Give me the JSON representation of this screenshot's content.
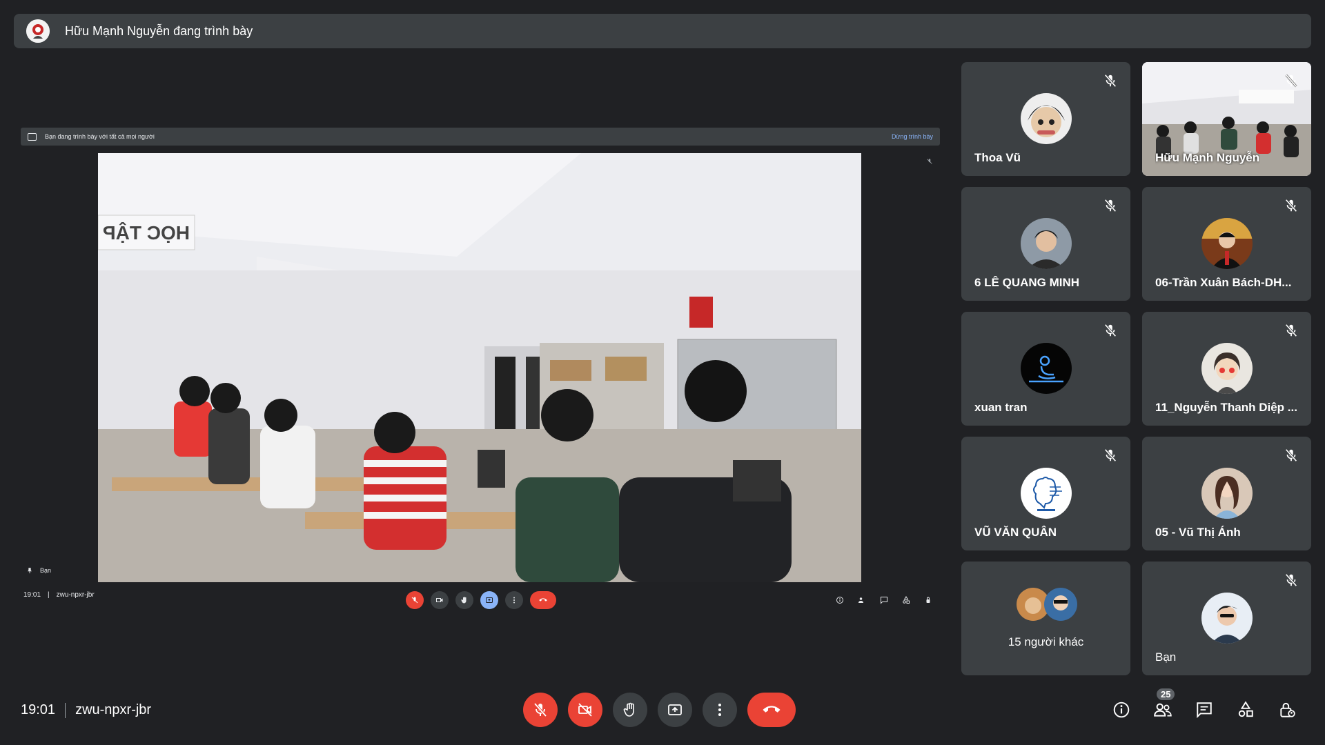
{
  "presenter_bar": {
    "title": "Hữu Mạnh Nguyễn đang trình bày"
  },
  "shared_screen": {
    "notice": "Bạn đang trình bày với tất cả mọi người",
    "stop_label": "Dừng trình bày",
    "self_label": "Bạn",
    "time": "19:01",
    "meeting_code": "zwu-npxr-jbr",
    "people_count": "25"
  },
  "participants": [
    {
      "name": "Thoa Vũ",
      "muted": true,
      "avatar": "cartoon-avatar"
    },
    {
      "name": "Hữu Mạnh Nguyễn",
      "muted": true,
      "avatar": "video-feed"
    },
    {
      "name": "6 LÊ QUANG MINH",
      "muted": true,
      "avatar": "photo-avatar"
    },
    {
      "name": "06-Trần Xuân Bách-DH...",
      "muted": true,
      "avatar": "photo-avatar"
    },
    {
      "name": "xuan tran",
      "muted": true,
      "avatar": "logo-avatar"
    },
    {
      "name": "11_Nguyễn Thanh Diệp ...",
      "muted": true,
      "avatar": "cartoon-avatar"
    },
    {
      "name": "VŨ VĂN QUÂN",
      "muted": true,
      "avatar": "brain-logo-avatar"
    },
    {
      "name": "05 - Vũ Thị Ánh",
      "muted": true,
      "avatar": "photo-avatar"
    },
    {
      "name": "15 người khác",
      "muted": false,
      "avatar": "group-avatars"
    },
    {
      "name": "Bạn",
      "muted": true,
      "avatar": "photo-avatar"
    }
  ],
  "footer": {
    "time": "19:01",
    "meeting_code": "zwu-npxr-jbr",
    "people_count": "25"
  },
  "colors": {
    "background": "#202124",
    "tile": "#3c4043",
    "danger": "#ea4335",
    "accent": "#8ab4f8"
  }
}
